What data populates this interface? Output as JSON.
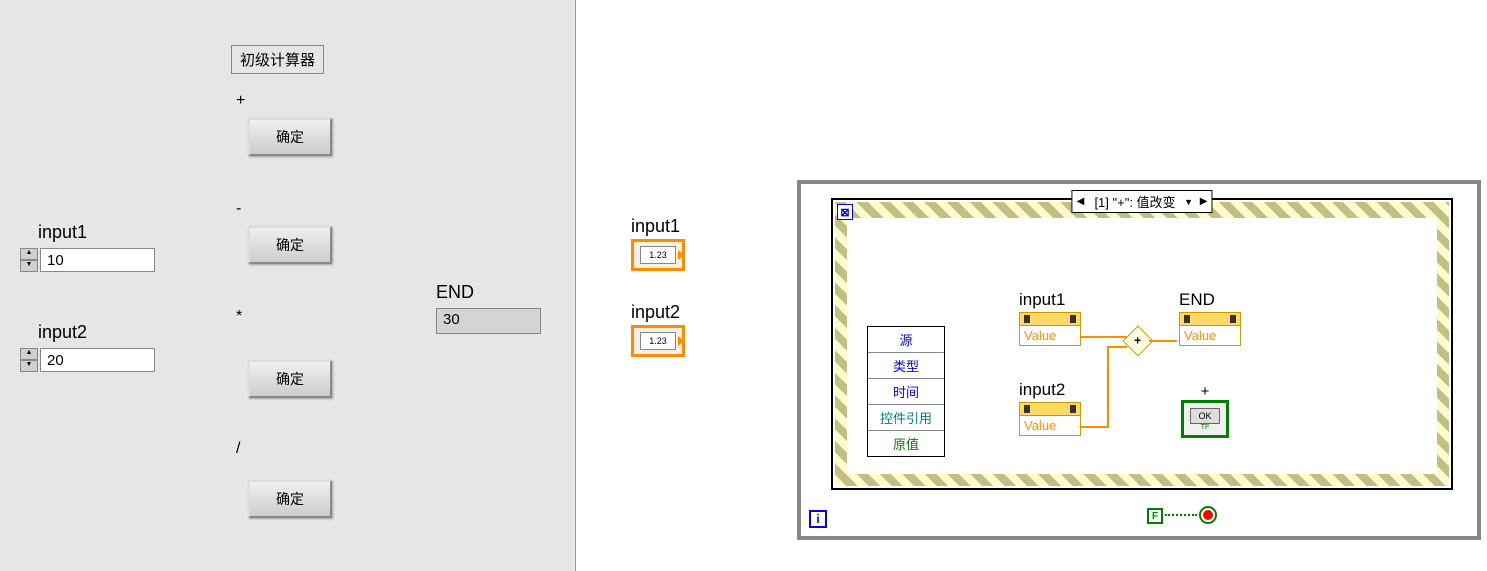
{
  "front_panel": {
    "title": "初级计算器",
    "input1_label": "input1",
    "input1_value": "10",
    "input2_label": "input2",
    "input2_value": "20",
    "end_label": "END",
    "end_value": "30",
    "operations": {
      "plus_label": "+",
      "minus_label": "-",
      "multiply_label": "*",
      "divide_label": "/"
    },
    "confirm_button": "确定"
  },
  "block_diagram": {
    "input1_label": "input1",
    "input2_label": "input2",
    "dbl_text": "1.23",
    "event_case": "[1] \"+\": 值改变",
    "unbundle_items": {
      "source": "源",
      "type": "类型",
      "time": "时间",
      "ctl_ref": "控件引用",
      "old_val": "原值"
    },
    "prop_input1_label": "input1",
    "prop_input2_label": "input2",
    "prop_end_label": "END",
    "prop_value_text": "Value",
    "plus_symbol": "+",
    "ok_text": "OK",
    "tf_text": "TF",
    "iter_text": "i",
    "false_text": "F",
    "dyn_text": "⊠"
  }
}
